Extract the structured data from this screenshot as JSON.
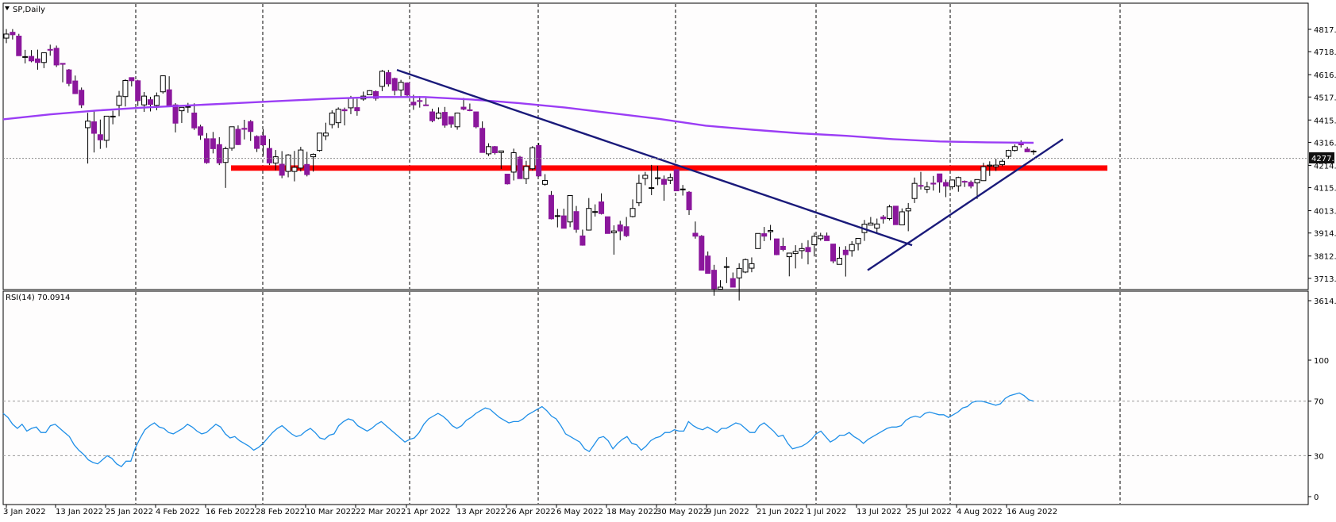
{
  "chart_data": [
    {
      "type": "candlestick",
      "title": "SP,Daily",
      "symbol": "SP",
      "timeframe": "Daily",
      "current_price_label": "4277.4",
      "y_ticks": [
        4817.0,
        4718.0,
        4616.0,
        4517.0,
        4415.0,
        4316.0,
        4214.0,
        4115.0,
        4013.0,
        3914.0,
        3812.0,
        3713.0,
        3614.0
      ],
      "ylim": [
        3600,
        4860
      ],
      "x_labels": [
        "3 Jan 2022",
        "13 Jan 2022",
        "25 Jan 2022",
        "4 Feb 2022",
        "16 Feb 2022",
        "28 Feb 2022",
        "10 Mar 2022",
        "22 Mar 2022",
        "1 Apr 2022",
        "13 Apr 2022",
        "26 Apr 2022",
        "6 May 2022",
        "18 May 2022",
        "30 May 2022",
        "9 Jun 2022",
        "21 Jun 2022",
        "1 Jul 2022",
        "13 Jul 2022",
        "25 Jul 2022",
        "4 Aug 2022",
        "16 Aug 2022"
      ],
      "grid": "vertical dashed separators",
      "candles_ohlc": [
        [
          4778,
          4818,
          4756,
          4796
        ],
        [
          4804,
          4818,
          4772,
          4793
        ],
        [
          4787,
          4797,
          4699,
          4700
        ],
        [
          4693,
          4726,
          4666,
          4696
        ],
        [
          4697,
          4725,
          4671,
          4677
        ],
        [
          4686,
          4727,
          4638,
          4670
        ],
        [
          4670,
          4713,
          4645,
          4713
        ],
        [
          4728,
          4749,
          4700,
          4726
        ],
        [
          4733,
          4745,
          4650,
          4659
        ],
        [
          4666,
          4666,
          4582,
          4662
        ],
        [
          4637,
          4641,
          4565,
          4577
        ],
        [
          4588,
          4612,
          4530,
          4532
        ],
        [
          4547,
          4559,
          4468,
          4482
        ],
        [
          4381,
          4447,
          4222,
          4410
        ],
        [
          4407,
          4453,
          4271,
          4356
        ],
        [
          4350,
          4417,
          4287,
          4327
        ],
        [
          4325,
          4432,
          4292,
          4432
        ],
        [
          4432,
          4456,
          4396,
          4432
        ],
        [
          4480,
          4544,
          4432,
          4521
        ],
        [
          4519,
          4596,
          4475,
          4590
        ],
        [
          4603,
          4596,
          4564,
          4589
        ],
        [
          4589,
          4593,
          4477,
          4501
        ],
        [
          4482,
          4539,
          4451,
          4521
        ],
        [
          4505,
          4518,
          4453,
          4484
        ],
        [
          4480,
          4537,
          4458,
          4522
        ],
        [
          4540,
          4612,
          4532,
          4611
        ],
        [
          4549,
          4609,
          4473,
          4477
        ],
        [
          4482,
          4490,
          4360,
          4401
        ],
        [
          4456,
          4465,
          4402,
          4471
        ],
        [
          4475,
          4491,
          4447,
          4475
        ],
        [
          4446,
          4489,
          4371,
          4380
        ],
        [
          4385,
          4394,
          4327,
          4348
        ],
        [
          4332,
          4357,
          4221,
          4226
        ],
        [
          4332,
          4362,
          4267,
          4288
        ],
        [
          4306,
          4339,
          4215,
          4225
        ],
        [
          4227,
          4297,
          4114,
          4288
        ],
        [
          4290,
          4385,
          4279,
          4385
        ],
        [
          4374,
          4391,
          4304,
          4306
        ],
        [
          4378,
          4416,
          4329,
          4374
        ],
        [
          4408,
          4415,
          4322,
          4364
        ],
        [
          4342,
          4347,
          4273,
          4289
        ],
        [
          4345,
          4374,
          4256,
          4305
        ],
        [
          4289,
          4331,
          4215,
          4225
        ],
        [
          4224,
          4282,
          4192,
          4252
        ],
        [
          4219,
          4277,
          4157,
          4170
        ],
        [
          4187,
          4264,
          4161,
          4260
        ],
        [
          4187,
          4278,
          4143,
          4205
        ],
        [
          4202,
          4296,
          4187,
          4282
        ],
        [
          4218,
          4274,
          4165,
          4173
        ],
        [
          4252,
          4267,
          4186,
          4263
        ],
        [
          4280,
          4358,
          4275,
          4357
        ],
        [
          4345,
          4403,
          4326,
          4357
        ],
        [
          4395,
          4458,
          4378,
          4446
        ],
        [
          4403,
          4471,
          4380,
          4463
        ],
        [
          4461,
          4470,
          4391,
          4456
        ],
        [
          4469,
          4522,
          4441,
          4512
        ],
        [
          4470,
          4509,
          4434,
          4456
        ],
        [
          4508,
          4541,
          4500,
          4521
        ],
        [
          4527,
          4547,
          4527,
          4545
        ],
        [
          4541,
          4546,
          4501,
          4511
        ],
        [
          4564,
          4637,
          4543,
          4631
        ],
        [
          4625,
          4637,
          4563,
          4575
        ],
        [
          4599,
          4603,
          4524,
          4546
        ],
        [
          4548,
          4593,
          4519,
          4582
        ],
        [
          4579,
          4582,
          4517,
          4526
        ],
        [
          4494,
          4527,
          4460,
          4482
        ],
        [
          4501,
          4521,
          4470,
          4500
        ],
        [
          4482,
          4512,
          4480,
          4481
        ],
        [
          4451,
          4465,
          4405,
          4412
        ],
        [
          4423,
          4471,
          4418,
          4446
        ],
        [
          4449,
          4473,
          4381,
          4392
        ],
        [
          4430,
          4431,
          4381,
          4397
        ],
        [
          4385,
          4448,
          4372,
          4446
        ],
        [
          4472,
          4513,
          4458,
          4463
        ],
        [
          4460,
          4488,
          4454,
          4459
        ],
        [
          4451,
          4451,
          4378,
          4385
        ],
        [
          4378,
          4409,
          4318,
          4271
        ],
        [
          4265,
          4312,
          4255,
          4297
        ],
        [
          4297,
          4300,
          4262,
          4270
        ],
        [
          4271,
          4277,
          4198,
          4278
        ],
        [
          4175,
          4175,
          4129,
          4132
        ],
        [
          4184,
          4288,
          4147,
          4270
        ],
        [
          4250,
          4256,
          4156,
          4155
        ],
        [
          4155,
          4234,
          4131,
          4209
        ],
        [
          4199,
          4299,
          4191,
          4292
        ],
        [
          4302,
          4313,
          4164,
          4167
        ],
        [
          4130,
          4175,
          4124,
          4147
        ],
        [
          4081,
          4100,
          3974,
          3977
        ],
        [
          3990,
          4021,
          3939,
          3991
        ],
        [
          3990,
          4022,
          3950,
          3935
        ],
        [
          3963,
          4080,
          3940,
          4080
        ],
        [
          4009,
          4034,
          3915,
          3930
        ],
        [
          3901,
          3929,
          3858,
          3860
        ],
        [
          3927,
          4069,
          3925,
          4023
        ],
        [
          4009,
          4041,
          3987,
          4009
        ],
        [
          4052,
          4090,
          3996,
          4000
        ],
        [
          3986,
          3986,
          3957,
          3912
        ],
        [
          3915,
          3948,
          3818,
          3923
        ],
        [
          3950,
          3968,
          3882,
          3923
        ],
        [
          3942,
          3985,
          3896,
          3902
        ],
        [
          3987,
          4063,
          3983,
          4023
        ],
        [
          4048,
          4173,
          4033,
          4134
        ],
        [
          4156,
          4185,
          4126,
          4170
        ],
        [
          4115,
          4216,
          4082,
          4115
        ],
        [
          4155,
          4212,
          4126,
          4159
        ],
        [
          4152,
          4169,
          4057,
          4130
        ],
        [
          4148,
          4178,
          4131,
          4160
        ],
        [
          4195,
          4166,
          4112,
          4101
        ],
        [
          4108,
          4127,
          4080,
          4109
        ],
        [
          4095,
          4100,
          3994,
          4017
        ],
        [
          3913,
          3965,
          3889,
          3900
        ],
        [
          3900,
          3905,
          3873,
          3749
        ],
        [
          3812,
          3832,
          3740,
          3735
        ],
        [
          3749,
          3773,
          3636,
          3667
        ],
        [
          3665,
          3705,
          3668,
          3674
        ],
        [
          3764,
          3807,
          3692,
          3765
        ],
        [
          3712,
          3739,
          3700,
          3674
        ],
        [
          3715,
          3780,
          3615,
          3757
        ],
        [
          3741,
          3801,
          3736,
          3796
        ],
        [
          3758,
          3806,
          3740,
          3778
        ],
        [
          3845,
          3896,
          3858,
          3912
        ],
        [
          3911,
          3941,
          3878,
          3900
        ],
        [
          3920,
          3950,
          3882,
          3925
        ],
        [
          3888,
          3844,
          3816,
          3818
        ],
        [
          3855,
          3893,
          3833,
          3841
        ],
        [
          3809,
          3815,
          3722,
          3825
        ],
        [
          3823,
          3860,
          3757,
          3832
        ],
        [
          3836,
          3870,
          3800,
          3845
        ],
        [
          3850,
          3882,
          3775,
          3831
        ],
        [
          3862,
          3915,
          3810,
          3899
        ],
        [
          3889,
          3915,
          3880,
          3902
        ],
        [
          3901,
          3916,
          3881,
          3880
        ],
        [
          3865,
          3855,
          3780,
          3790
        ],
        [
          3775,
          3853,
          3781,
          3802
        ],
        [
          3838,
          3856,
          3721,
          3818
        ],
        [
          3836,
          3878,
          3809,
          3863
        ],
        [
          3867,
          3883,
          3837,
          3890
        ],
        [
          3916,
          3972,
          3879,
          3953
        ],
        [
          3949,
          3985,
          3948,
          3958
        ],
        [
          3936,
          3978,
          3911,
          3954
        ],
        [
          3985,
          3994,
          3956,
          3977
        ],
        [
          3978,
          4039,
          3970,
          4030
        ],
        [
          4033,
          3946,
          3969,
          3951
        ],
        [
          3950,
          4023,
          3956,
          4008
        ],
        [
          4012,
          4047,
          3922,
          4023
        ],
        [
          4067,
          4160,
          4047,
          4134
        ],
        [
          4125,
          4185,
          4107,
          4123
        ],
        [
          4108,
          4141,
          4091,
          4118
        ],
        [
          4135,
          4167,
          4102,
          4131
        ],
        [
          4176,
          4176,
          4093,
          4140
        ],
        [
          4138,
          4151,
          4073,
          4122
        ],
        [
          4119,
          4151,
          4108,
          4149
        ],
        [
          4123,
          4164,
          4097,
          4160
        ],
        [
          4143,
          4147,
          4118,
          4141
        ],
        [
          4139,
          4147,
          4112,
          4122
        ],
        [
          4136,
          4149,
          4065,
          4151
        ],
        [
          4146,
          4225,
          4176,
          4208
        ],
        [
          4211,
          4232,
          4167,
          4215
        ],
        [
          4208,
          4243,
          4189,
          4215
        ],
        [
          4217,
          4242,
          4210,
          4232
        ],
        [
          4254,
          4283,
          4243,
          4280
        ],
        [
          4280,
          4307,
          4275,
          4297
        ],
        [
          4312,
          4325,
          4293,
          4305
        ],
        [
          4286,
          4296,
          4281,
          4274
        ],
        [
          4275,
          4283,
          4261,
          4277
        ]
      ],
      "ma_series": {
        "name": "",
        "values": [
          4418,
          4440,
          4457,
          4470,
          4480,
          4490,
          4500,
          4510,
          4517,
          4517,
          4506,
          4490,
          4470,
          4445,
          4420,
          4390,
          4372,
          4356,
          4345,
          4330,
          4320,
          4316,
          4314
        ]
      },
      "support_zone": [
        4190,
        4214
      ],
      "trendlines": [
        {
          "from": [
            "1 Apr 2022",
            4637
          ],
          "to": [
            "13 Jul 2022",
            3860
          ]
        },
        {
          "from": [
            "13 Jul 2022",
            3749
          ],
          "to": [
            "16 Aug 2022",
            4330
          ]
        }
      ],
      "colors": {
        "bull_body": "#ffffff",
        "bear_body": "#8b179c",
        "wick": "#000000",
        "ma": "#9b3df5",
        "trendline": "#1a1a7a",
        "zone": "#ff0000",
        "bg": "#fefdfd"
      }
    },
    {
      "type": "line",
      "title": "RSI(14) 70.0914",
      "y_ticks": [
        100,
        70,
        30,
        0
      ],
      "levels": [
        70,
        30
      ],
      "ylim": [
        0,
        100
      ],
      "series": [
        {
          "name": "RSI(14)",
          "values": [
            61,
            58,
            53,
            50,
            53,
            48,
            50,
            51,
            47,
            47,
            52,
            53,
            50,
            47,
            44,
            38,
            34,
            31,
            27,
            25,
            24,
            27,
            30,
            28,
            24,
            22,
            26,
            26,
            36,
            43,
            49,
            52,
            54,
            51,
            50,
            47,
            46,
            48,
            50,
            53,
            51,
            48,
            46,
            47,
            50,
            53,
            51,
            46,
            43,
            44,
            41,
            39,
            37,
            34,
            36,
            39,
            43,
            47,
            50,
            52,
            49,
            46,
            44,
            45,
            48,
            50,
            47,
            43,
            42,
            45,
            46,
            52,
            55,
            57,
            56,
            52,
            50,
            48,
            50,
            53,
            55,
            52,
            49,
            46,
            43,
            40,
            42,
            43,
            47,
            53,
            57,
            59,
            61,
            59,
            56,
            52,
            50,
            52,
            56,
            58,
            61,
            63,
            65,
            64,
            61,
            58,
            56,
            54,
            55,
            55,
            57,
            60,
            62,
            64,
            66,
            63,
            59,
            57,
            52,
            46,
            44,
            42,
            40,
            35,
            33,
            38,
            43,
            44,
            41,
            35,
            39,
            42,
            44,
            39,
            38,
            34,
            37,
            41,
            43,
            44,
            47,
            47,
            49,
            48,
            48,
            55,
            52,
            50,
            49,
            51,
            49,
            47,
            50,
            50,
            52,
            54,
            53,
            50,
            47,
            47,
            52,
            54,
            51,
            48,
            44,
            45,
            39,
            35,
            36,
            37,
            39,
            42,
            46,
            48,
            44,
            40,
            42,
            45,
            45,
            47,
            44,
            42,
            39,
            42,
            44,
            46,
            48,
            50,
            51,
            51,
            52,
            56,
            58,
            59,
            58,
            61,
            62,
            61,
            60,
            60,
            58,
            60,
            62,
            65,
            66,
            69,
            70,
            70,
            69,
            68,
            67,
            68,
            72,
            74,
            75,
            76,
            74,
            71,
            70
          ]
        }
      ],
      "color": "#1f8fe8"
    }
  ]
}
